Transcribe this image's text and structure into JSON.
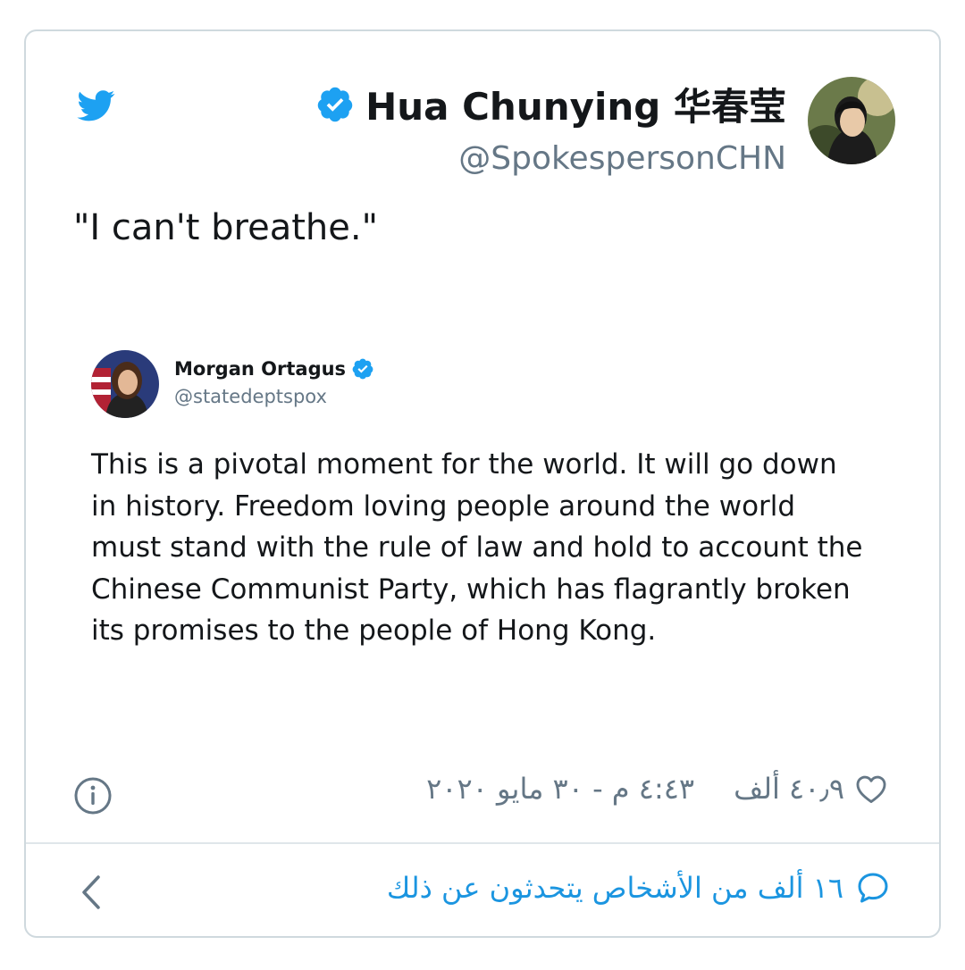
{
  "tweet": {
    "author_name": "Hua Chunying 华春莹",
    "author_handle": "@SpokespersonCHN",
    "text": "\"I can't breathe.\""
  },
  "quoted_tweet": {
    "author_name": "Morgan Ortagus",
    "author_handle": "@statedeptspox",
    "lines": [
      "This is a pivotal moment for the world. It will go down",
      "in history. Freedom loving people around the world",
      "must stand with the rule of law and hold to account the",
      "Chinese Communist Party, which has flagrantly broken",
      "its promises to the people of Hong Kong."
    ]
  },
  "footer": {
    "likes": "٤٠٫٩ ألف",
    "timestamp": "٤:٤٣ م - ٣٠ مايو ٢٠٢٠",
    "conversation": "١٦ ألف من الأشخاص يتحدثون عن ذلك"
  },
  "icons": {
    "brand": "twitter-bird-icon",
    "verified": "verified-badge-icon",
    "info": "info-icon",
    "like": "heart-icon",
    "reply": "speech-bubble-icon",
    "back": "chevron-left-icon"
  },
  "colors": {
    "twitter_blue": "#1da1f2",
    "link_blue": "#1b95e0",
    "secondary_text": "#657786",
    "border": "#cfd9de"
  }
}
